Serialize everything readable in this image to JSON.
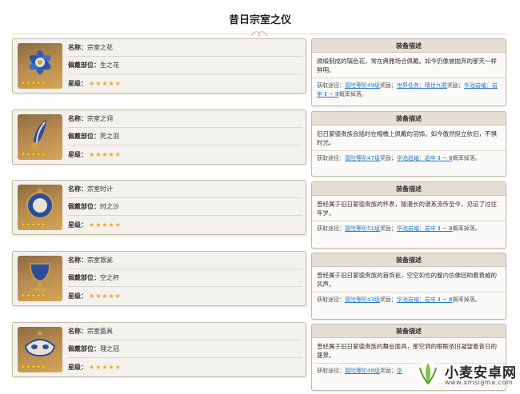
{
  "page": {
    "title": "昔日宗室之仪"
  },
  "labels": {
    "name": "名称：",
    "slot": "佩戴部位：",
    "rarity": "星级：",
    "desc_header": "装备描述",
    "src_prefix": "获取途径："
  },
  "stars": "★★★★★",
  "items": [
    {
      "name": "宗室之花",
      "slot": "生之花",
      "desc": "绸缎制成的璃色花，常在典雅场合佩戴。如今仍像被抛弃的那天一样鲜明。",
      "src_links": [
        "冒险等阶49级",
        "世界任务：晴世九君",
        "华池岩岫：岩牢 Ⅱ ~ Ⅲ"
      ],
      "src_parts": [
        "奖励；",
        "奖励；",
        "概率掉落。"
      ]
    },
    {
      "name": "宗室之翎",
      "slot": "死之羽",
      "desc": "旧日蒙德贵族会插时在帽檐上佩戴的羽饰。如今傲然挺立依旧，不惧时光。",
      "src_links": [
        "冒险等阶47级",
        "华池岩岫：岩牢 Ⅱ ~ Ⅲ"
      ],
      "src_parts": [
        "奖励；",
        "概率掉落。"
      ]
    },
    {
      "name": "宗室时计",
      "slot": "时之沙",
      "desc": "曾经属于旧日蒙德贵族的怀表，随漫长的谱系流传至今，见证了过往年岁。",
      "src_links": [
        "冒险等阶51级",
        "华池岩岫：岩牢 Ⅱ ~ Ⅲ"
      ],
      "src_parts": [
        "奖励；",
        "概率掉落。"
      ]
    },
    {
      "name": "宗室银瓮",
      "slot": "空之杯",
      "desc": "曾经属于旧日蒙德贵族的首饰瓮，空空如也的腹内仿佛回响着衰威的风声。",
      "src_links": [
        "冒险等阶43级",
        "华池岩岫：岩牢 Ⅱ ~ Ⅲ"
      ],
      "src_parts": [
        "奖励；",
        "概率掉落。"
      ]
    },
    {
      "name": "宗室面具",
      "slot": "理之冠",
      "desc": "曾经属于旧日蒙德贵族的舞会面具，那空洞的眼眶依旧凝望着昔日的盛景。",
      "src_links": [
        "冒险等阶48级",
        "华"
      ],
      "src_parts": [
        "奖励；",
        ""
      ]
    }
  ],
  "watermark": {
    "text": "小麦安卓网",
    "url": "www.xmsigma.com"
  },
  "colors": {
    "accent_link": "#2a7ac9",
    "star": "#f5a623",
    "border": "#c9b9a6"
  }
}
